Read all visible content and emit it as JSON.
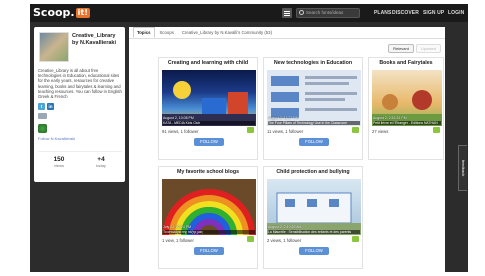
{
  "header": {
    "logo_text": "Scoop.",
    "logo_badge": "it!",
    "search_placeholder": "Search fonts/ideas",
    "nav": [
      "PLANS",
      "DISCOVER",
      "SIGN UP",
      "LOGIN"
    ]
  },
  "profile": {
    "name": "Creative_Library by N.Kavallieraki",
    "bio": "Creative_Library is all about free technologies in Education, educational sites for the early years, resources for creative learning, books and fairytales & learning and teaching resources. You can follow in English Greek & French",
    "follow_link": "Follow N.Kavallieraki",
    "stats": [
      {
        "number": "150",
        "label": "views"
      },
      {
        "number": "+4",
        "label": "today"
      }
    ]
  },
  "tabs": [
    "Topics",
    "Scoops",
    "Creative_Library by N.Kavalli's Community (53)"
  ],
  "sort": [
    "Relevant",
    "Updated"
  ],
  "cards": [
    {
      "title": "Creating and learning with child",
      "date": "August 2, 10:08 PM",
      "caption": "ΚΑΤΑ - MEDIA Kids Club",
      "views": "91 views, 1 follower",
      "follow": "FOLLOW"
    },
    {
      "title": "New technologies in Education",
      "date": "August 2, 11:27 PM",
      "caption": "The Four Pillars of Technology Use in the Classroom",
      "views": "11 views, 1 follower",
      "follow": "FOLLOW"
    },
    {
      "title": "Books and Fairytales",
      "date": "August 2, 2:52:31 PM",
      "caption": "Petit lièvre et l'Étranger - Editions NATHAN",
      "views": "27 views",
      "follow": "FOLLOW"
    },
    {
      "title": "My favorite school blogs",
      "date": "July 23, 12:24 PM",
      "caption": "Το ιστολόγιο της τάξης μας",
      "views": "1 view, 1 follower",
      "follow": "FOLLOW"
    },
    {
      "title": "Child protection and bullying",
      "date": "August 2, 2:10:26 AM",
      "caption": "La Maurelle : Sensibilisation des enfants et des parents",
      "views": "2 views, 1 follower",
      "follow": "FOLLOW"
    }
  ],
  "feedback": "feedback"
}
